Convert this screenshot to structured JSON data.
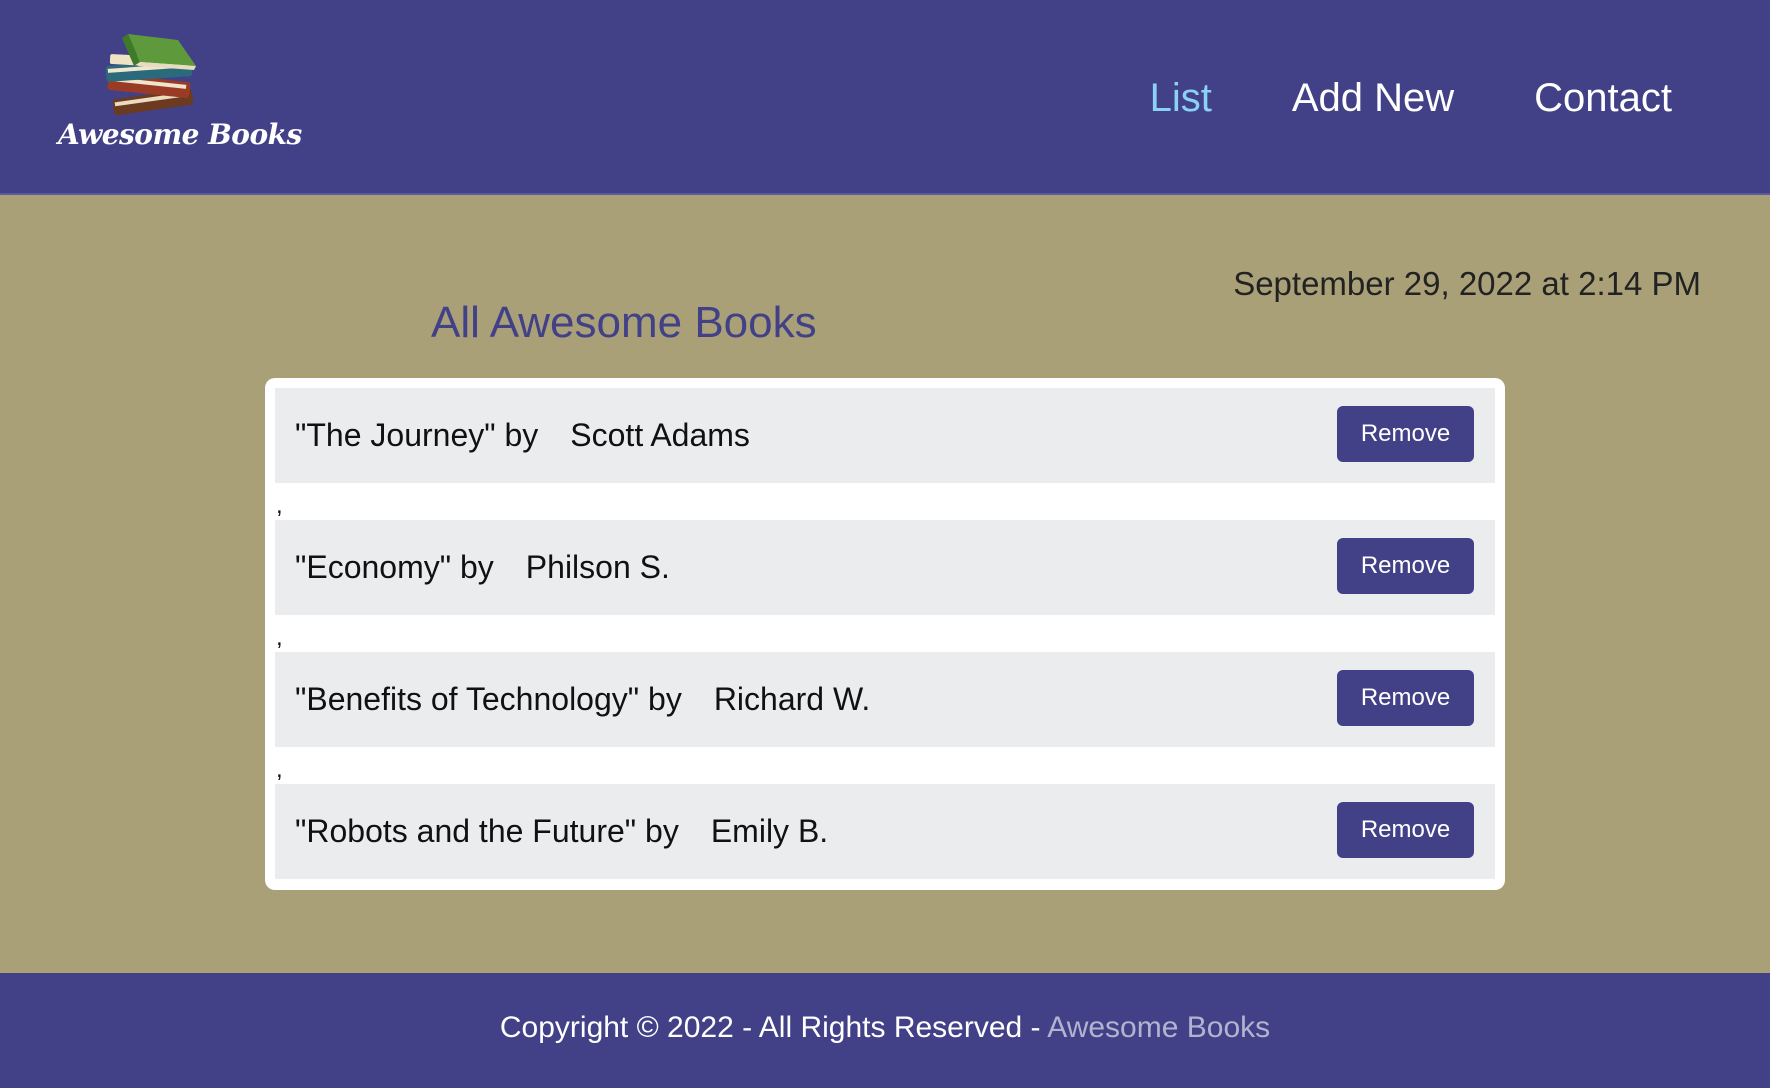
{
  "header": {
    "logo_text": "Awesome Books",
    "nav": [
      {
        "label": "List",
        "active": true
      },
      {
        "label": "Add New",
        "active": false
      },
      {
        "label": "Contact",
        "active": false
      }
    ]
  },
  "main": {
    "datetime": "September 29, 2022 at 2:14 PM",
    "title": "All Awesome Books",
    "books": [
      {
        "title": "\"The Journey\" by",
        "author": "Scott Adams",
        "remove_label": "Remove"
      },
      {
        "title": "\"Economy\" by",
        "author": "Philson S.",
        "remove_label": "Remove"
      },
      {
        "title": "\"Benefits of Technology\" by",
        "author": "Richard W.",
        "remove_label": "Remove"
      },
      {
        "title": "\"Robots and the Future\" by",
        "author": "Emily B.",
        "remove_label": "Remove"
      }
    ],
    "separator": ","
  },
  "footer": {
    "text": "Copyright © 2022 - All Rights Reserved - ",
    "brand": "Awesome Books"
  },
  "colors": {
    "header_bg": "#424187",
    "body_bg": "#a9a078",
    "nav_active": "#8ad1f5",
    "row_bg": "#ebecee",
    "button_bg": "#424187",
    "footer_brand": "#b3b3cf"
  },
  "icons": {
    "logo": "books-stack-icon"
  }
}
